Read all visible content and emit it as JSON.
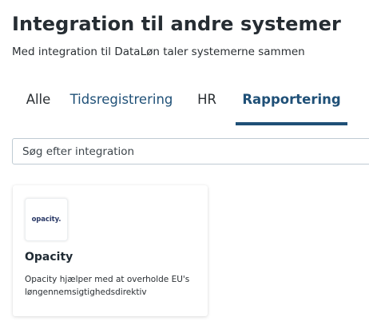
{
  "header": {
    "title": "Integration til andre systemer",
    "subtitle": "Med integration til DataLøn taler systemerne sammen"
  },
  "tabs": [
    {
      "label": "Alle",
      "active": false
    },
    {
      "label": "Tidsregistrering",
      "active": false
    },
    {
      "label": "HR",
      "active": false
    },
    {
      "label": "Rapportering",
      "active": true
    }
  ],
  "search": {
    "placeholder": "Søg efter integration",
    "value": ""
  },
  "integrations": [
    {
      "logo_text": "opacity.",
      "name": "Opacity",
      "description": "Opacity hjælper med at overholde EU's løngennemsigtighedsdirektiv"
    }
  ],
  "colors": {
    "accent": "#1f5077",
    "text": "#2a2f33",
    "logo": "#2b3a67"
  }
}
